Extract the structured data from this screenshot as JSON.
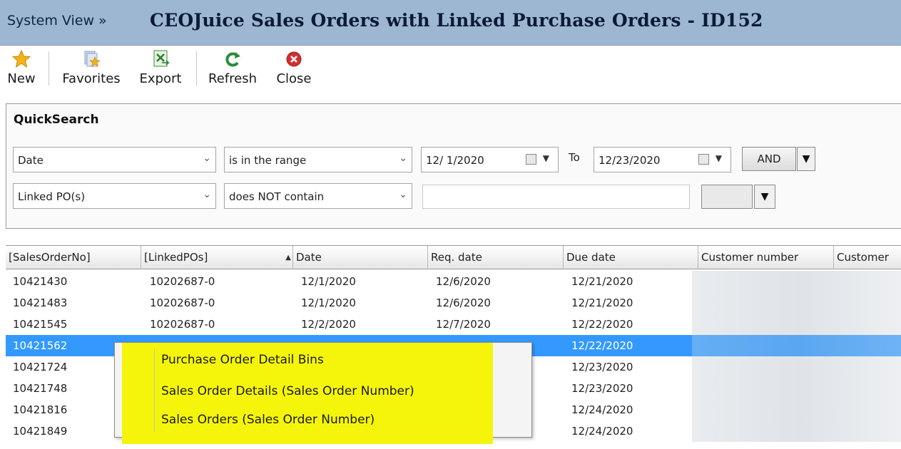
{
  "header": {
    "breadcrumb": "System View »",
    "title": "CEOJuice Sales Orders with Linked Purchase Orders - ID152"
  },
  "toolbar": {
    "new": "New",
    "favorites": "Favorites",
    "export": "Export",
    "refresh": "Refresh",
    "close": "Close"
  },
  "quicksearch": {
    "title": "QuickSearch",
    "row1": {
      "field": "Date",
      "operator": "is in the range",
      "from": "12/ 1/2020",
      "to_label": "To",
      "to": "12/23/2020",
      "logic": "AND"
    },
    "row2": {
      "field": "Linked PO(s)",
      "operator": "does NOT contain",
      "value": ""
    }
  },
  "grid": {
    "columns": [
      "[SalesOrderNo]",
      "[LinkedPOs]",
      "Date",
      "Req. date",
      "Due date",
      "Customer number",
      "Customer"
    ],
    "rows": [
      {
        "so": "10421430",
        "po": "10202687-0",
        "date": "12/1/2020",
        "req": "12/6/2020",
        "due": "12/21/2020"
      },
      {
        "so": "10421483",
        "po": "10202687-0",
        "date": "12/1/2020",
        "req": "12/6/2020",
        "due": "12/21/2020"
      },
      {
        "so": "10421545",
        "po": "10202687-0",
        "date": "12/2/2020",
        "req": "12/7/2020",
        "due": "12/22/2020"
      },
      {
        "so": "10421562",
        "po": "",
        "date": "",
        "req": "",
        "due": "12/22/2020"
      },
      {
        "so": "10421724",
        "po": "",
        "date": "",
        "req": "",
        "due": "12/23/2020"
      },
      {
        "so": "10421748",
        "po": "",
        "date": "",
        "req": "",
        "due": "12/23/2020"
      },
      {
        "so": "10421816",
        "po": "",
        "date": "",
        "req": "",
        "due": "12/24/2020"
      },
      {
        "so": "10421849",
        "po": "",
        "date": "",
        "req": "",
        "due": "12/24/2020"
      }
    ],
    "selected_row": 3
  },
  "context_menu": {
    "items": [
      "Purchase Order Detail Bins",
      "Sales Order Details   (Sales Order Number)",
      "Sales Orders   (Sales Order Number)"
    ]
  },
  "colors": {
    "titlebar": "#9db7d3",
    "selection": "#3399ff",
    "highlight": "#f5f50b"
  },
  "icons": [
    "star-icon",
    "favorites-icon",
    "export-icon",
    "refresh-icon",
    "close-icon",
    "calendar-icon",
    "chevron-down-icon",
    "sort-up-icon"
  ]
}
